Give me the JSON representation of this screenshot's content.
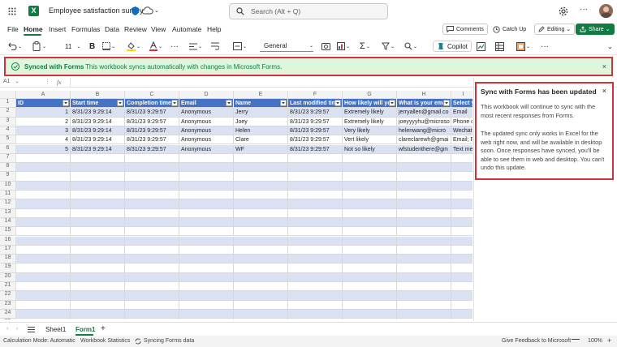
{
  "titlebar": {
    "doc_title": "Employee satisfaction survey",
    "search_placeholder": "Search (Alt + Q)"
  },
  "menu": {
    "items": [
      "File",
      "Home",
      "Insert",
      "Formulas",
      "Data",
      "Review",
      "View",
      "Automate",
      "Help"
    ],
    "comments": "Comments",
    "catchup": "Catch Up",
    "editing": "Editing",
    "share": "Share"
  },
  "ribbon": {
    "font_size": "11",
    "bold": "B",
    "number_format": "General",
    "copilot": "Copilot"
  },
  "banner": {
    "title": "Synced with Forms",
    "text": "This workbook syncs automatically with changes in Microsoft Forms.",
    "close": "×"
  },
  "formula": {
    "cell_ref": "A1",
    "fx": "fx"
  },
  "grid": {
    "col_letters": [
      "A",
      "B",
      "C",
      "D",
      "E",
      "F",
      "G",
      "H",
      "I"
    ],
    "headers": [
      "ID",
      "Start time",
      "Completion time",
      "Email",
      "Name",
      "Last modified time",
      "How likely will you",
      "What is your email",
      "Select yo"
    ],
    "rows": [
      [
        "1",
        "8/31/23 9:29:14",
        "8/31/23 9:29:57",
        "Anonymous",
        "Jerry",
        "8/31/23 9:29:57",
        "Extremely likely",
        "jerryallen@gmail.co",
        "Email"
      ],
      [
        "2",
        "8/31/23 9:29:14",
        "8/31/23 9:29:57",
        "Anonymous",
        "Joey",
        "8/31/23 9:29:57",
        "Extremely likely",
        "joeyyyyhu@microso",
        "Phone c"
      ],
      [
        "3",
        "8/31/23 9:29:14",
        "8/31/23 9:29:57",
        "Anonymous",
        "Helen",
        "8/31/23 9:29:57",
        "Very likely",
        "helenwang@micro",
        "Wechat"
      ],
      [
        "4",
        "8/31/23 9:29:14",
        "8/31/23 9:29:57",
        "Anonymous",
        "Clare",
        "8/31/23 9:29:57",
        "Vert likely",
        "clareclarewh@gmai",
        "Email; F"
      ],
      [
        "5",
        "8/31/23 9:29:14",
        "8/31/23 9:29:57",
        "Anonymous",
        "WF",
        "8/31/23 9:29:57",
        "Not so likely",
        "wfstudenthere@gm",
        "Text me"
      ]
    ],
    "row_numbers": [
      "1",
      "2",
      "3",
      "4",
      "5",
      "6",
      "7",
      "8",
      "9",
      "10",
      "11",
      "12",
      "13",
      "14",
      "15",
      "16",
      "17",
      "18",
      "19",
      "20",
      "21",
      "22",
      "23",
      "24",
      "25"
    ]
  },
  "pane": {
    "title": "Sync with Forms has been updated",
    "close": "×",
    "p1": "This workbook will continue to sync with the most recent responses from Forms.",
    "p2": "The updated sync only works in Excel for the web right now, and will be available in desktop soon. Once responses have synced, you'll be able to see them in web and desktop. You can't undo this update."
  },
  "sheets": {
    "tabs": [
      "Sheet1",
      "Form1"
    ],
    "active": "Form1",
    "add": "+"
  },
  "status": {
    "calc": "Calculation Mode: Automatic",
    "stats": "Workbook Statistics",
    "syncing": "Syncing Forms data",
    "feedback": "Give Feedback to Microsoft",
    "zoom": "100%"
  },
  "colors": {
    "accent": "#107c41",
    "highlight": "#d13438",
    "table_header": "#4472c4",
    "band": "#d9e1f2"
  }
}
